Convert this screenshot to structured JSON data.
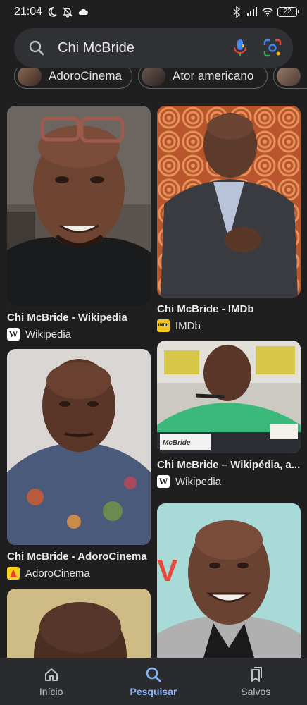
{
  "status_bar": {
    "time": "21:04",
    "battery": "22"
  },
  "search": {
    "query": "Chi McBride"
  },
  "chips": [
    {
      "label": "AdoroCinema"
    },
    {
      "label": "Ator americano"
    }
  ],
  "results": [
    {
      "title": "Chi McBride - Wikipedia",
      "source": "Wikipedia",
      "favicon": "wikipedia-icon"
    },
    {
      "title": "Chi McBride - IMDb",
      "source": "IMDb",
      "favicon": "imdb-icon"
    },
    {
      "title": "Chi McBride - AdoroCinema",
      "source": "AdoroCinema",
      "favicon": "adorocinema-icon"
    },
    {
      "title": "Chi McBride – Wikipédia, a...",
      "source": "Wikipedia",
      "favicon": "wikipedia-icon"
    },
    {
      "title": "",
      "source": ""
    },
    {
      "title": "",
      "source": ""
    }
  ],
  "image_texts": {
    "nameplate": "McBride"
  },
  "bottom_nav": [
    {
      "label": "Início",
      "icon": "home-icon"
    },
    {
      "label": "Pesquisar",
      "icon": "search-icon",
      "active": true
    },
    {
      "label": "Salvos",
      "icon": "bookmarks-icon"
    }
  ],
  "colors": {
    "background": "#1f1f1f",
    "search_bar": "#303134",
    "accent": "#8ab4f8"
  }
}
